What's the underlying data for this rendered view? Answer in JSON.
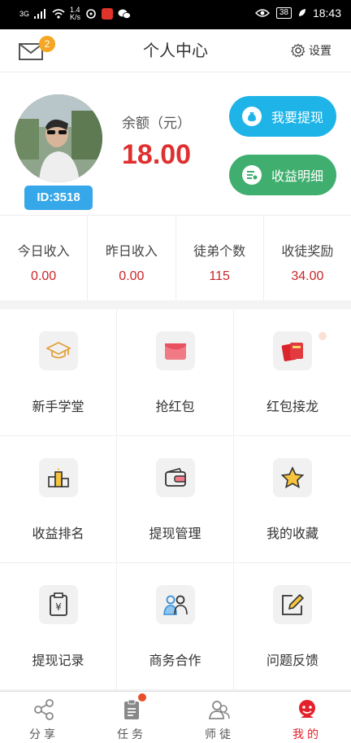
{
  "status_bar": {
    "signal": "3G",
    "speed": "1.4",
    "speed_unit": "K/s",
    "battery": "38",
    "time": "18:43"
  },
  "header": {
    "title": "个人中心",
    "mail_badge": "2",
    "settings_label": "设置"
  },
  "profile": {
    "user_id": "ID:3518",
    "balance_label": "余额（元）",
    "balance_value": "18.00",
    "withdraw_button": "我要提现",
    "income_detail_button": "收益明细"
  },
  "stats": [
    {
      "label": "今日收入",
      "value": "0.00"
    },
    {
      "label": "昨日收入",
      "value": "0.00"
    },
    {
      "label": "徒弟个数",
      "value": "115"
    },
    {
      "label": "收徒奖励",
      "value": "34.00"
    }
  ],
  "menu": [
    {
      "label": "新手学堂",
      "icon": "graduation-cap-icon"
    },
    {
      "label": "抢红包",
      "icon": "red-envelope-icon"
    },
    {
      "label": "红包接龙",
      "icon": "red-envelope-chain-icon"
    },
    {
      "label": "收益排名",
      "icon": "ranking-podium-icon"
    },
    {
      "label": "提现管理",
      "icon": "wallet-icon"
    },
    {
      "label": "我的收藏",
      "icon": "star-icon"
    },
    {
      "label": "提现记录",
      "icon": "withdraw-record-icon"
    },
    {
      "label": "商务合作",
      "icon": "partners-icon"
    },
    {
      "label": "问题反馈",
      "icon": "feedback-icon"
    }
  ],
  "tabs": [
    {
      "label": "分享",
      "icon": "share-icon"
    },
    {
      "label": "任务",
      "icon": "task-icon"
    },
    {
      "label": "师徒",
      "icon": "mentor-icon"
    },
    {
      "label": "我的",
      "icon": "profile-icon",
      "active": true
    }
  ],
  "colors": {
    "accent_red": "#e02f2f",
    "withdraw_blue": "#1eb4e8",
    "detail_green": "#3fae6e",
    "id_badge_blue": "#36a7e8",
    "mail_badge_orange": "#f5a623"
  }
}
